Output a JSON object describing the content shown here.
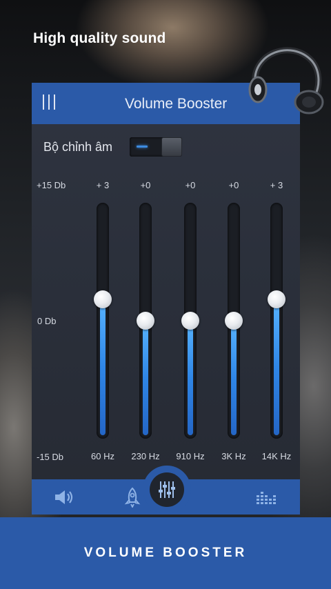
{
  "promo": {
    "headline": "High quality sound",
    "footer_title": "VOLUME BOOSTER"
  },
  "app": {
    "title": "Volume Booster",
    "menu_icon": "menu-icon"
  },
  "equalizer": {
    "toggle_label": "Bộ chỉnh âm",
    "toggle_on": true,
    "db_labels": {
      "max": "+15 Db",
      "mid": "0 Db",
      "min": "-15 Db"
    },
    "range_db": [
      -15,
      15
    ],
    "bands": [
      {
        "freq": "60 Hz",
        "value_label": "+ 3",
        "value_db": 3
      },
      {
        "freq": "230 Hz",
        "value_label": "+0",
        "value_db": 0
      },
      {
        "freq": "910 Hz",
        "value_label": "+0",
        "value_db": 0
      },
      {
        "freq": "3K Hz",
        "value_label": "+0",
        "value_db": 0
      },
      {
        "freq": "14K Hz",
        "value_label": "+ 3",
        "value_db": 3
      }
    ]
  },
  "bottom_nav": {
    "items": [
      "speaker-icon",
      "rocket-icon",
      "equalizer-sliders-icon",
      "visualizer-bars-icon"
    ],
    "active": "equalizer-sliders-icon"
  },
  "colors": {
    "accent": "#2b5aa8",
    "slider_fill": "#3d8be0",
    "panel": "#2c313c"
  }
}
